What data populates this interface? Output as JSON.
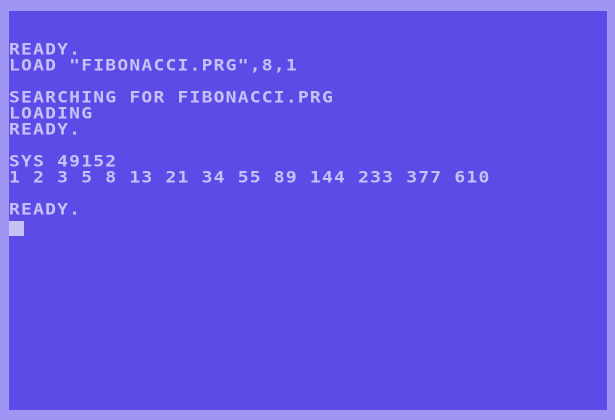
{
  "screen": {
    "colors": {
      "border": "#9f96f4",
      "background": "#5d4be8",
      "text": "#c6c2f7"
    },
    "lines": [
      "READY.",
      "LOAD \"FIBONACCI.PRG\",8,1",
      "",
      "SEARCHING FOR FIBONACCI.PRG",
      "LOADING",
      "READY.",
      "",
      "SYS 49152",
      "1 2 3 5 8 13 21 34 55 89 144 233 377 610",
      "",
      "READY."
    ],
    "cursor_icon": "block-cursor-icon"
  }
}
